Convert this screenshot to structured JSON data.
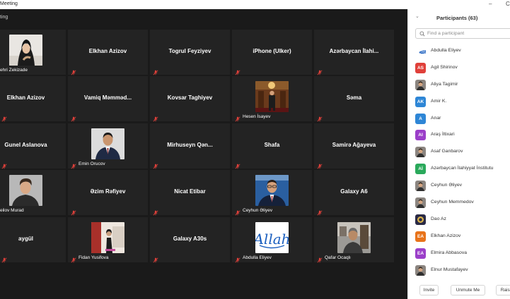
{
  "window": {
    "title": "Meeting",
    "minimize_glyph": "–",
    "close_glyph": "C"
  },
  "gallery": {
    "meeting_label": "ting",
    "tiles": [
      {
        "text": "ehri Zekizade",
        "kind": "photo",
        "photo": "woman-hijab"
      },
      {
        "text": "Elkhan Azizov",
        "kind": "name"
      },
      {
        "text": "Togrul Feyziyev",
        "kind": "name"
      },
      {
        "text": "iPhone (Ulker)",
        "kind": "name"
      },
      {
        "text": "Azərbaycan  İlahi...",
        "kind": "name"
      },
      {
        "text": "Elkhan Azizov",
        "kind": "name"
      },
      {
        "text": "Vamiq  Məmməd...",
        "kind": "name"
      },
      {
        "text": "Kovsar Taghiyev",
        "kind": "name"
      },
      {
        "text": "Hesen İsayev",
        "kind": "photo",
        "photo": "man-in-hall"
      },
      {
        "text": "Səma",
        "kind": "name"
      },
      {
        "text": "Gunel Aslanova",
        "kind": "name"
      },
      {
        "text": "Emin Orucov",
        "kind": "photo",
        "photo": "man-in-suit"
      },
      {
        "text": "Mirhuseyn  Qən...",
        "kind": "name"
      },
      {
        "text": "Shafa",
        "kind": "name"
      },
      {
        "text": "Samirə Ağayeva",
        "kind": "name"
      },
      {
        "text": "eilov Murad",
        "kind": "photo",
        "photo": "young-man"
      },
      {
        "text": "Əzim Rəfiyev",
        "kind": "name"
      },
      {
        "text": "Nicat Etibar",
        "kind": "name"
      },
      {
        "text": "Ceyhun Əliyev",
        "kind": "photo",
        "photo": "man-glasses"
      },
      {
        "text": "Galaxy A6",
        "kind": "name"
      },
      {
        "text": "aygül",
        "kind": "name"
      },
      {
        "text": "Fidan Yusifova",
        "kind": "photo",
        "photo": "woman-standing"
      },
      {
        "text": "Galaxy A30s",
        "kind": "name"
      },
      {
        "text": "Abdulla Eliyev",
        "kind": "photo",
        "photo": "allah-calligraphy"
      },
      {
        "text": "Qafar Ocaqlı",
        "kind": "photo",
        "photo": "man-indoors"
      }
    ]
  },
  "participants": {
    "collapse_glyph": "⌄",
    "title": "Participants (63)",
    "search_placeholder": "Find a participant",
    "list": [
      {
        "name": "Abdulla Eliyev",
        "avatar_type": "image",
        "avatar_icon": "allah-calligraphy"
      },
      {
        "name": "Agil Shirinov",
        "avatar_type": "initials",
        "initials": "AS",
        "color": "#e0403a"
      },
      {
        "name": "Aliya Tagimir",
        "avatar_type": "image",
        "avatar_icon": "person-photo"
      },
      {
        "name": "Amir K.",
        "avatar_type": "initials",
        "initials": "AK",
        "color": "#2e86d6"
      },
      {
        "name": "Anar",
        "avatar_type": "initials",
        "initials": "A",
        "color": "#2e86d6"
      },
      {
        "name": "Araş İltixari",
        "avatar_type": "initials",
        "initials": "AI",
        "color": "#9b3fc9"
      },
      {
        "name": "Asaf Ganbarov",
        "avatar_type": "image",
        "avatar_icon": "person-photo"
      },
      {
        "name": "Azərbaycan İlahiyyat İnstitutu",
        "avatar_type": "initials",
        "initials": "Aİ",
        "color": "#2aa95b"
      },
      {
        "name": "Ceyhun Əliyev",
        "avatar_type": "image",
        "avatar_icon": "person-photo"
      },
      {
        "name": "Ceyhun Memmedov",
        "avatar_type": "image",
        "avatar_icon": "person-photo"
      },
      {
        "name": "Dao Az",
        "avatar_type": "image",
        "avatar_icon": "logo-photo"
      },
      {
        "name": "Elkhan Azizov",
        "avatar_type": "initials",
        "initials": "EA",
        "color": "#e8731a"
      },
      {
        "name": "Elmira Abbasova",
        "avatar_type": "initials",
        "initials": "EA",
        "color": "#9b3fc9"
      },
      {
        "name": "Elnur Mustafayev",
        "avatar_type": "image",
        "avatar_icon": "person-photo"
      }
    ]
  },
  "footer": {
    "invite": "Invite",
    "unmute_me": "Unmute Me",
    "raise": "Raise"
  },
  "colors": {
    "muted_mic": "#e0403a",
    "tile_bg": "#232323",
    "gallery_bg": "#1a1a1a"
  }
}
